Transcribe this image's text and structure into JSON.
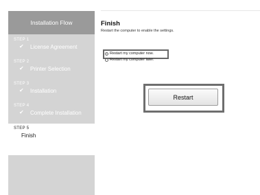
{
  "sidebar": {
    "header": "Installation Flow",
    "steps": [
      {
        "num": "STEP 1",
        "label": "License Agreement",
        "completed": true
      },
      {
        "num": "STEP 2",
        "label": "Printer Selection",
        "completed": true
      },
      {
        "num": "STEP 3",
        "label": "Installation",
        "completed": true
      },
      {
        "num": "STEP 4",
        "label": "Complete Installation",
        "completed": true
      },
      {
        "num": "STEP 5",
        "label": "Finish",
        "completed": false,
        "current": true
      }
    ]
  },
  "main": {
    "title": "Finish",
    "subtitle": "Restart the computer to enable the settings.",
    "options": [
      {
        "label": "Restart my computer now.",
        "selected": true
      },
      {
        "label": "Restart my computer later.",
        "selected": false
      }
    ],
    "restart_button": "Restart"
  },
  "icons": {
    "check": "check-icon"
  },
  "colors": {
    "sidebar": "#d4d4d4",
    "header": "#9a9a9a",
    "highlight_border": "#6e6e6e"
  }
}
